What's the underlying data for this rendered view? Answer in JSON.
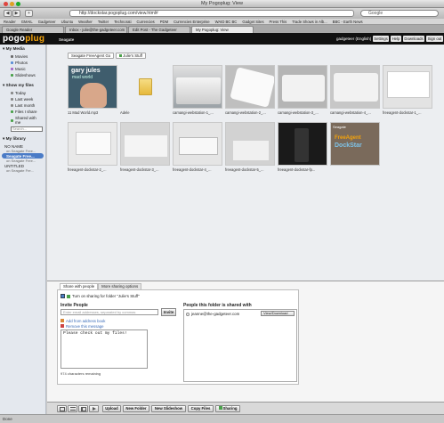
{
  "window": {
    "title": "My Pogoplug: View"
  },
  "browser": {
    "url": "http://dockstar.pogoplug.com/view.html#",
    "search_placeholder": "Google",
    "back": "◀",
    "forward": "▶",
    "add": "+",
    "bookmarks": [
      "Reader",
      "GMAIL",
      "Gadgeteer",
      "Ubuntu",
      "Weather",
      "Twitter",
      "Technorati",
      "Currencies",
      "PDM",
      "Currencies Enterprise",
      "WAID BC BC",
      "Gadget Sites",
      "Press This",
      "Trade Shows in Alb...",
      "BBC - Earth News"
    ],
    "tabs": [
      "Google Reader",
      "Inbox - julie@the-gadgeteer.com",
      "Edit Post - The Gadgeteer",
      "My Pogoplug: View"
    ],
    "active_tab": 3
  },
  "header": {
    "logo_text": "pogo",
    "logo_accent": "plug",
    "brand": "Seagate",
    "user": "gadgeteer (English)",
    "buttons": [
      "Settings",
      "Help",
      "Downloads",
      "Sign out"
    ]
  },
  "sidebar": {
    "media_title": "My Media",
    "media_items": [
      "Movies",
      "Photos",
      "Music",
      "Slideshows"
    ],
    "files_title": "Show my files",
    "files_items": [
      "Today",
      "Last week",
      "Last month",
      "Files I share",
      "Shared with me"
    ],
    "search_placeholder": "Search...",
    "library_title": "My library",
    "devices": [
      {
        "name": "NO NAME",
        "sub": "on Seagate Free..."
      },
      {
        "name": "Seagate Free...",
        "sub": "on Seagate Free..."
      },
      {
        "name": "UNTITLED",
        "sub": "on Seagate Fre..."
      }
    ]
  },
  "breadcrumb": [
    "Seagate FreeAgent Go",
    "Julie's Stuff"
  ],
  "thumbs": [
    {
      "label": "11 Mad World.mp3"
    },
    {
      "label": "Adele"
    },
    {
      "label": "camangi-webstation-1_..."
    },
    {
      "label": "camangi-webstation-2_..."
    },
    {
      "label": "camangi-webstation-3_..."
    },
    {
      "label": "camangi-webstation-4_..."
    },
    {
      "label": "freeagent-dockstar-1_..."
    },
    {
      "label": "freeagent-dockstar-2_..."
    },
    {
      "label": "freeagent-dockstar-3_..."
    },
    {
      "label": "freeagent-dockstar-4_..."
    },
    {
      "label": "freeagent-dockstar-5_..."
    },
    {
      "label": "freeagent-dockstar-fp..."
    }
  ],
  "album_text": {
    "line1": "gary jules",
    "line2": "mad world"
  },
  "dockstar_text": {
    "brand": "Seagate",
    "line1": "FreeAgent",
    "line2": "DockStar"
  },
  "share": {
    "tabs": [
      "Share with people",
      "More sharing options"
    ],
    "toggle_label": "Turn on sharing for folder \"Julie's Stuff\"",
    "invite_title": "Invite People",
    "invite_placeholder": "Enter email addresses, separated by commas",
    "invite_button": "Invite",
    "add_from_book": "Add from address book",
    "remove_message": "Remove this message",
    "message": "Please check out my files!",
    "chars_remaining": "974 characters remaining",
    "shared_title": "People this folder is shared with",
    "shared_people": [
      {
        "email": "jeanne@the-gadgeteer.com",
        "permission": "View/Download"
      }
    ]
  },
  "footer": {
    "buttons": [
      "Upload",
      "New Folder",
      "New Slideshow",
      "Copy Files",
      "Sharing"
    ]
  },
  "status": "Done"
}
